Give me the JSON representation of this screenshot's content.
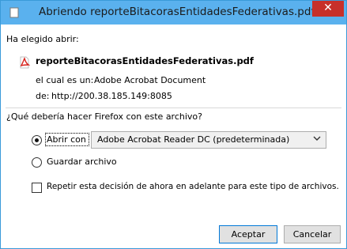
{
  "window": {
    "title": "Abriendo reporteBitacorasEntidadesFederativas.pdf",
    "close_glyph": "✕"
  },
  "dialog": {
    "intro_label": "Ha elegido abrir:",
    "file_name": "reporteBitacorasEntidadesFederativas.pdf",
    "type_prefix": "el cual es un:",
    "type_value": "Adobe Acrobat Document",
    "from_prefix": "de:",
    "from_value": "http://200.38.185.149:8085",
    "question": "¿Qué debería hacer Firefox con este archivo?",
    "open_with_label": "Abrir con",
    "open_with_app": "Adobe Acrobat Reader DC  (predeterminada)",
    "save_label": "Guardar archivo",
    "remember_label": "Repetir esta decisión de ahora en adelante para este tipo de archivos.",
    "open_with_selected": true,
    "save_selected": false,
    "remember_checked": false
  },
  "buttons": {
    "accept": "Aceptar",
    "cancel": "Cancelar"
  },
  "colors": {
    "titlebar": "#5ab1ee",
    "close": "#c7302a",
    "accent": "#0078d7"
  },
  "icons": {
    "title": "firefox-document-icon",
    "file": "pdf-file-icon",
    "dropdown": "chevron-down-icon"
  }
}
